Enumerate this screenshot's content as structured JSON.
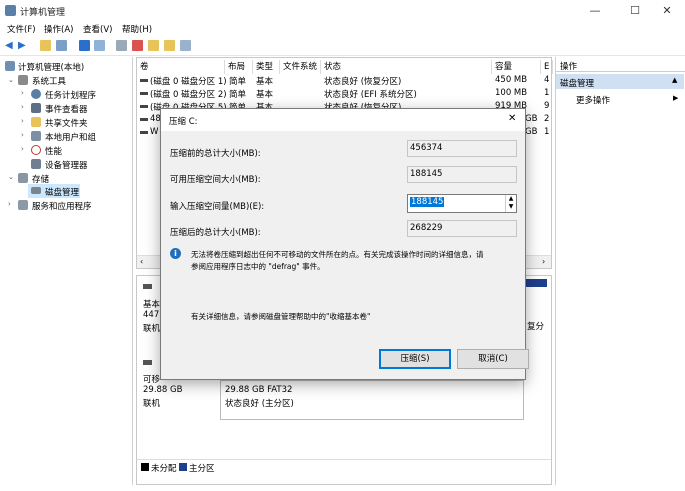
{
  "window": {
    "title": "计算机管理",
    "min": "—",
    "max": "☐",
    "close": "✕"
  },
  "menu": {
    "file": "文件(F)",
    "action": "操作(A)",
    "view": "查看(V)",
    "help": "帮助(H)"
  },
  "tree": {
    "root": "计算机管理(本地)",
    "system_tools": "系统工具",
    "task_scheduler": "任务计划程序",
    "event_viewer": "事件查看器",
    "shared_folders": "共享文件夹",
    "local_users": "本地用户和组",
    "performance": "性能",
    "device_manager": "设备管理器",
    "storage": "存储",
    "disk_management": "磁盘管理",
    "services": "服务和应用程序"
  },
  "list": {
    "headers": [
      "卷",
      "布局",
      "类型",
      "文件系统",
      "状态",
      "容量",
      "E"
    ],
    "rows": [
      [
        "(磁盘 0 磁盘分区 1)",
        "简单",
        "基本",
        "",
        "状态良好 (恢复分区)",
        "450 MB",
        "4"
      ],
      [
        "(磁盘 0 磁盘分区 2)",
        "简单",
        "基本",
        "",
        "状态良好 (EFI 系统分区)",
        "100 MB",
        "1"
      ],
      [
        "(磁盘 0 磁盘分区 5)",
        "简单",
        "基本",
        "",
        "状态良好 (恢复分区)",
        "919 MB",
        "9"
      ],
      [
        "48",
        "",
        "",
        "",
        "",
        "GB",
        "2"
      ],
      [
        "W",
        "",
        "",
        "",
        "",
        "GB",
        "1"
      ]
    ]
  },
  "lower": {
    "disk0_l1": "基本",
    "disk0_l2": "447.",
    "disk0_l3": "联机",
    "disk0_right": "复分",
    "disk1_l1": "可移",
    "disk1_l2": "29.88 GB",
    "disk1_l3": "联机",
    "part_size": "29.88 GB FAT32",
    "part_status": "状态良好 (主分区)",
    "legend_unalloc": "未分配",
    "legend_primary": "主分区"
  },
  "actions": {
    "header": "操作",
    "section": "磁盘管理",
    "more": "更多操作"
  },
  "dialog": {
    "title": "压缩 C:",
    "label_total": "压缩前的总计大小(MB):",
    "value_total": "456374",
    "label_available": "可用压缩空间大小(MB):",
    "value_available": "188145",
    "label_input": "输入压缩空间量(MB)(E):",
    "value_input": "188145",
    "label_after": "压缩后的总计大小(MB):",
    "value_after": "268229",
    "info": "无法将卷压缩到超出任何不可移动的文件所在的点。有关完成该操作时间的详细信息，请参阅应用程序日志中的 \"defrag\" 事件。",
    "info_line1": "无法将卷压缩到超出任何不可移动的文件所在的点。有关完成该操作时间的详细信息，请",
    "info_line2": "参阅应用程序日志中的 \"defrag\" 事件。",
    "detail": "有关详细信息，请参阅磁盘管理帮助中的\"收缩基本卷\"",
    "ok": "压缩(S)",
    "cancel": "取消(C)"
  },
  "colors": {
    "accent": "#0078d7",
    "selected": "#cce8ff",
    "disk_bar": "#1e3f8a"
  }
}
